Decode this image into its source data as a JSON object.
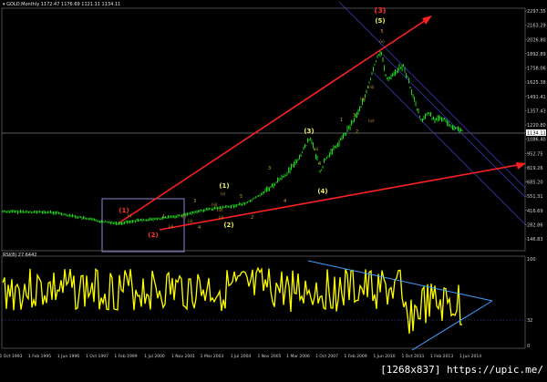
{
  "header": {
    "symbol_line": "▾ GOLD,Monthly  1172.47 1176.69 1121.11 1134.11",
    "indicator_line": "RSI(8) 27.6442"
  },
  "price_axis": {
    "labels": [
      "2297.35",
      "2163.29",
      "2026.80",
      "1892.89",
      "1758.06",
      "1625.38",
      "1491.41",
      "1357.43",
      "1220.80",
      "1086.40",
      "952.75",
      "819.26",
      "685.20",
      "551.31",
      "416.69",
      "282.86",
      "146.83"
    ],
    "current": "1134.11"
  },
  "rsi_axis": {
    "labels": [
      "100",
      "32",
      "0"
    ]
  },
  "time_axis": {
    "labels": [
      "1 Oct 1993",
      "1 Feb 1995",
      "1 Jun 1996",
      "1 Oct 1997",
      "1 Feb 1999",
      "1 Jul 2000",
      "1 Nov 2001",
      "1 Mar 2003",
      "1 Jul 2004",
      "1 Nov 2005",
      "1 Mar 2006",
      "1 Oct 2007",
      "1 Feb 2009",
      "1 Jun 2010",
      "1 Oct 2011",
      "1 Feb 2013",
      "1 Jun 2014"
    ]
  },
  "wave_labels": {
    "big_red_3": "(3)",
    "yellow_5": "(5)",
    "small_5": "5",
    "red_1": "(1)",
    "red_2": "(2)",
    "yellow_1": "(1)",
    "yellow_2": "(2)",
    "yellow_3": "(3)",
    "yellow_4": "(4)",
    "minor_1": "1",
    "minor_2": "2",
    "minor_3": "3",
    "minor_4": "4",
    "minor_5": "5",
    "roman_i": "(i)",
    "roman_ii": "(ii)",
    "roman_iii": "(iii)",
    "roman_iv": "(iv)",
    "roman_v": "(v)"
  },
  "colors": {
    "candles": "#1fd21f",
    "rsi_line": "#ffff00",
    "trend_red": "#ff2020",
    "channel_blue": "#3c3cd2",
    "triangle_blue": "#3fa0ff",
    "box": "#8a8ad8"
  },
  "watermark": "[1268x837] https://upic.me/"
}
